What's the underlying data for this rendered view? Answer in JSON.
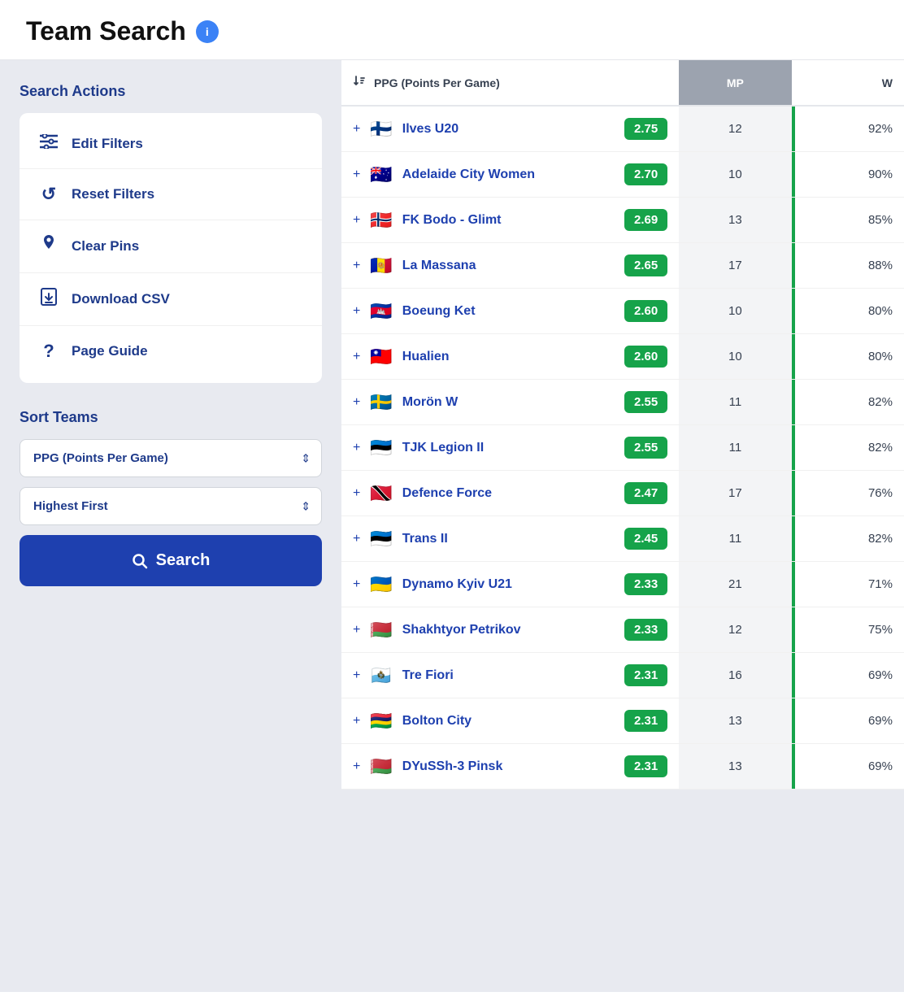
{
  "header": {
    "title": "Team Search",
    "info_icon": "i"
  },
  "sidebar": {
    "search_actions_label": "Search Actions",
    "actions": [
      {
        "id": "edit-filters",
        "label": "Edit Filters",
        "icon": "≡"
      },
      {
        "id": "reset-filters",
        "label": "Reset Filters",
        "icon": "↺"
      },
      {
        "id": "clear-pins",
        "label": "Clear Pins",
        "icon": "📌"
      },
      {
        "id": "download-csv",
        "label": "Download CSV",
        "icon": "📄"
      },
      {
        "id": "page-guide",
        "label": "Page Guide",
        "icon": "?"
      }
    ],
    "sort_teams_label": "Sort Teams",
    "sort_options": {
      "field": "PPG (Points Per Game)",
      "direction": "Highest First"
    },
    "search_button_label": "Search"
  },
  "table": {
    "columns": {
      "ppg_label": "PPG (Points Per Game)",
      "mp_label": "MP",
      "w_label": "W"
    },
    "rows": [
      {
        "name": "Ilves U20",
        "flag": "🇫🇮",
        "ppg": "2.75",
        "mp": 12,
        "w": "92%",
        "action": "+"
      },
      {
        "name": "Adelaide City Women",
        "flag": "🇦🇺",
        "ppg": "2.70",
        "mp": 10,
        "w": "90%",
        "action": "+"
      },
      {
        "name": "FK Bodo - Glimt",
        "flag": "🇳🇴",
        "ppg": "2.69",
        "mp": 13,
        "w": "85%",
        "action": "+"
      },
      {
        "name": "La Massana",
        "flag": "🇦🇩",
        "ppg": "2.65",
        "mp": 17,
        "w": "88%",
        "action": "+"
      },
      {
        "name": "Boeung Ket",
        "flag": "🇰🇭",
        "ppg": "2.60",
        "mp": 10,
        "w": "80%",
        "action": "+"
      },
      {
        "name": "Hualien",
        "flag": "🇹🇼",
        "ppg": "2.60",
        "mp": 10,
        "w": "80%",
        "action": "+"
      },
      {
        "name": "Morön W",
        "flag": "🇸🇪",
        "ppg": "2.55",
        "mp": 11,
        "w": "82%",
        "action": "+"
      },
      {
        "name": "TJK Legion II",
        "flag": "🇪🇪",
        "ppg": "2.55",
        "mp": 11,
        "w": "82%",
        "action": "+"
      },
      {
        "name": "Defence Force",
        "flag": "🇹🇹",
        "ppg": "2.47",
        "mp": 17,
        "w": "76%",
        "action": "+"
      },
      {
        "name": "Trans II",
        "flag": "🇪🇪",
        "ppg": "2.45",
        "mp": 11,
        "w": "82%",
        "action": "+"
      },
      {
        "name": "Dynamo Kyiv U21",
        "flag": "🇺🇦",
        "ppg": "2.33",
        "mp": 21,
        "w": "71%",
        "action": "+"
      },
      {
        "name": "Shakhtyor Petrikov",
        "flag": "🇧🇾",
        "ppg": "2.33",
        "mp": 12,
        "w": "75%",
        "action": "+"
      },
      {
        "name": "Tre Fiori",
        "flag": "🇸🇲",
        "ppg": "2.31",
        "mp": 16,
        "w": "69%",
        "action": "+"
      },
      {
        "name": "Bolton City",
        "flag": "🇲🇺",
        "ppg": "2.31",
        "mp": 13,
        "w": "69%",
        "action": "+"
      },
      {
        "name": "DYuSSh-3 Pinsk",
        "flag": "🇧🇾",
        "ppg": "2.31",
        "mp": 13,
        "w": "69%",
        "action": "+"
      }
    ]
  }
}
